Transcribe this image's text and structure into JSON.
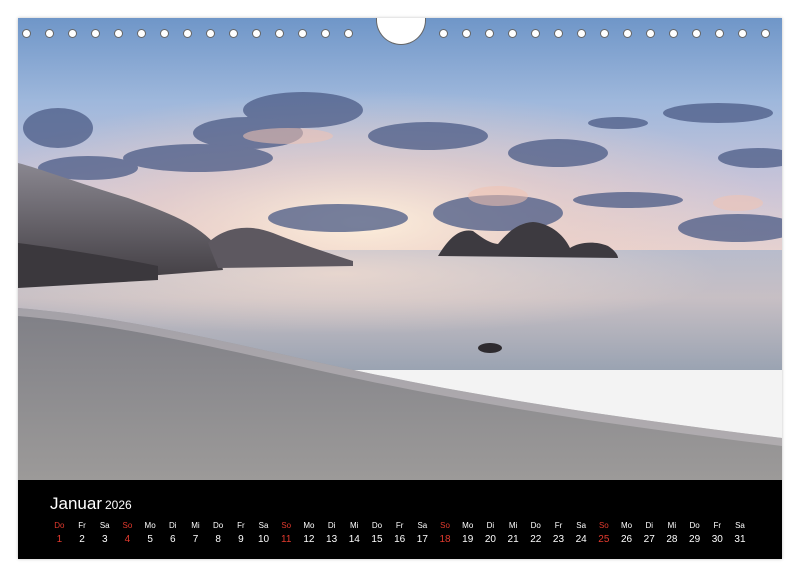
{
  "calendar": {
    "month": "Januar",
    "year": "2026",
    "accent_color": "#e23a2e",
    "days": [
      {
        "abbr": "Do",
        "num": "1",
        "red": true
      },
      {
        "abbr": "Fr",
        "num": "2",
        "red": false
      },
      {
        "abbr": "Sa",
        "num": "3",
        "red": false
      },
      {
        "abbr": "So",
        "num": "4",
        "red": true
      },
      {
        "abbr": "Mo",
        "num": "5",
        "red": false
      },
      {
        "abbr": "Di",
        "num": "6",
        "red": false
      },
      {
        "abbr": "Mi",
        "num": "7",
        "red": false
      },
      {
        "abbr": "Do",
        "num": "8",
        "red": false
      },
      {
        "abbr": "Fr",
        "num": "9",
        "red": false
      },
      {
        "abbr": "Sa",
        "num": "10",
        "red": false
      },
      {
        "abbr": "So",
        "num": "11",
        "red": true
      },
      {
        "abbr": "Mo",
        "num": "12",
        "red": false
      },
      {
        "abbr": "Di",
        "num": "13",
        "red": false
      },
      {
        "abbr": "Mi",
        "num": "14",
        "red": false
      },
      {
        "abbr": "Do",
        "num": "15",
        "red": false
      },
      {
        "abbr": "Fr",
        "num": "16",
        "red": false
      },
      {
        "abbr": "Sa",
        "num": "17",
        "red": false
      },
      {
        "abbr": "So",
        "num": "18",
        "red": true
      },
      {
        "abbr": "Mo",
        "num": "19",
        "red": false
      },
      {
        "abbr": "Di",
        "num": "20",
        "red": false
      },
      {
        "abbr": "Mi",
        "num": "21",
        "red": false
      },
      {
        "abbr": "Do",
        "num": "22",
        "red": false
      },
      {
        "abbr": "Fr",
        "num": "23",
        "red": false
      },
      {
        "abbr": "Sa",
        "num": "24",
        "red": false
      },
      {
        "abbr": "So",
        "num": "25",
        "red": true
      },
      {
        "abbr": "Mo",
        "num": "26",
        "red": false
      },
      {
        "abbr": "Di",
        "num": "27",
        "red": false
      },
      {
        "abbr": "Mi",
        "num": "28",
        "red": false
      },
      {
        "abbr": "Do",
        "num": "29",
        "red": false
      },
      {
        "abbr": "Fr",
        "num": "30",
        "red": false
      },
      {
        "abbr": "Sa",
        "num": "31",
        "red": false
      }
    ]
  }
}
